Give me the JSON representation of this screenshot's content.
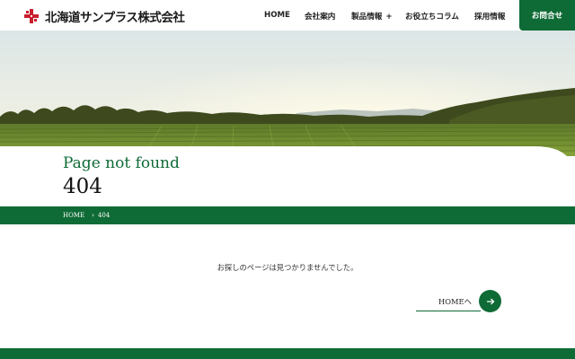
{
  "header": {
    "company_name": "北海道サンプラス株式会社",
    "nav": [
      {
        "label": "HOME",
        "has_plus": false
      },
      {
        "label": "会社案内",
        "has_plus": false
      },
      {
        "label": "製品情報",
        "has_plus": true
      },
      {
        "label": "お役立ちコラム",
        "has_plus": false
      },
      {
        "label": "採用情報",
        "has_plus": false
      }
    ],
    "contact_label": "お問合せ"
  },
  "page": {
    "subtitle": "Page not found",
    "code": "404"
  },
  "breadcrumb": {
    "home": "HOME",
    "current": "404"
  },
  "main": {
    "message": "お探しのページは見つかりませんでした。",
    "home_link_label": "HOMEへ"
  },
  "colors": {
    "brand_green": "#0f6b36",
    "logo_red": "#c8202f"
  }
}
